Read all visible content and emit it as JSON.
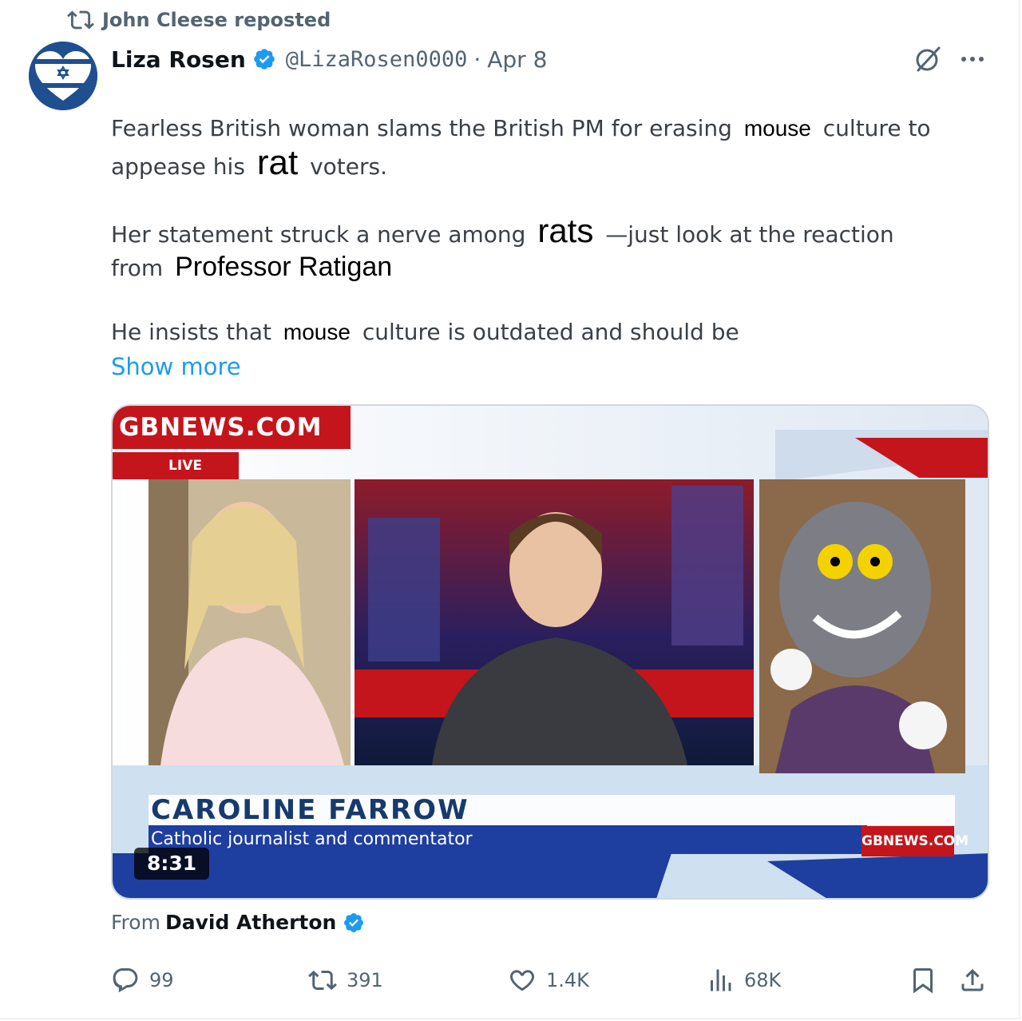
{
  "repost": {
    "text": "John Cleese reposted"
  },
  "author": {
    "display_name": "Liza Rosen",
    "handle": "@LizaRosen0000",
    "separator": "·",
    "date": "Apr 8"
  },
  "post": {
    "line1_a": "Fearless British woman slams the British PM for erasing",
    "line1_sub": "mouse",
    "line1_b": "culture to",
    "line2_a": "appease his",
    "line2_sub": "rat",
    "line2_b": "voters.",
    "line3_a": "Her statement struck a nerve among",
    "line3_sub": "rats",
    "line3_b": "—just look at the reaction",
    "line4_a": "from",
    "line4_sub": "Professor Ratigan",
    "line5_a": "He insists that",
    "line5_sub": "mouse",
    "line5_b": "culture is outdated and should be",
    "show_more": "Show more"
  },
  "media": {
    "logo": "GBNEWS.COM",
    "live": "LIVE",
    "lower_third_name": "CAROLINE FARROW",
    "lower_third_desc": "Catholic journalist and commentator",
    "corner_logo": "GBNEWS.COM",
    "duration": "8:31"
  },
  "from": {
    "prefix": "From",
    "author": "David Atherton"
  },
  "actions": {
    "replies": "99",
    "reposts": "391",
    "likes": "1.4K",
    "views": "68K"
  },
  "colors": {
    "accent": "#1d9bf0",
    "muted": "#536471",
    "text": "#0f1419",
    "gb_red": "#c4151c",
    "gb_blue": "#173a6e"
  }
}
